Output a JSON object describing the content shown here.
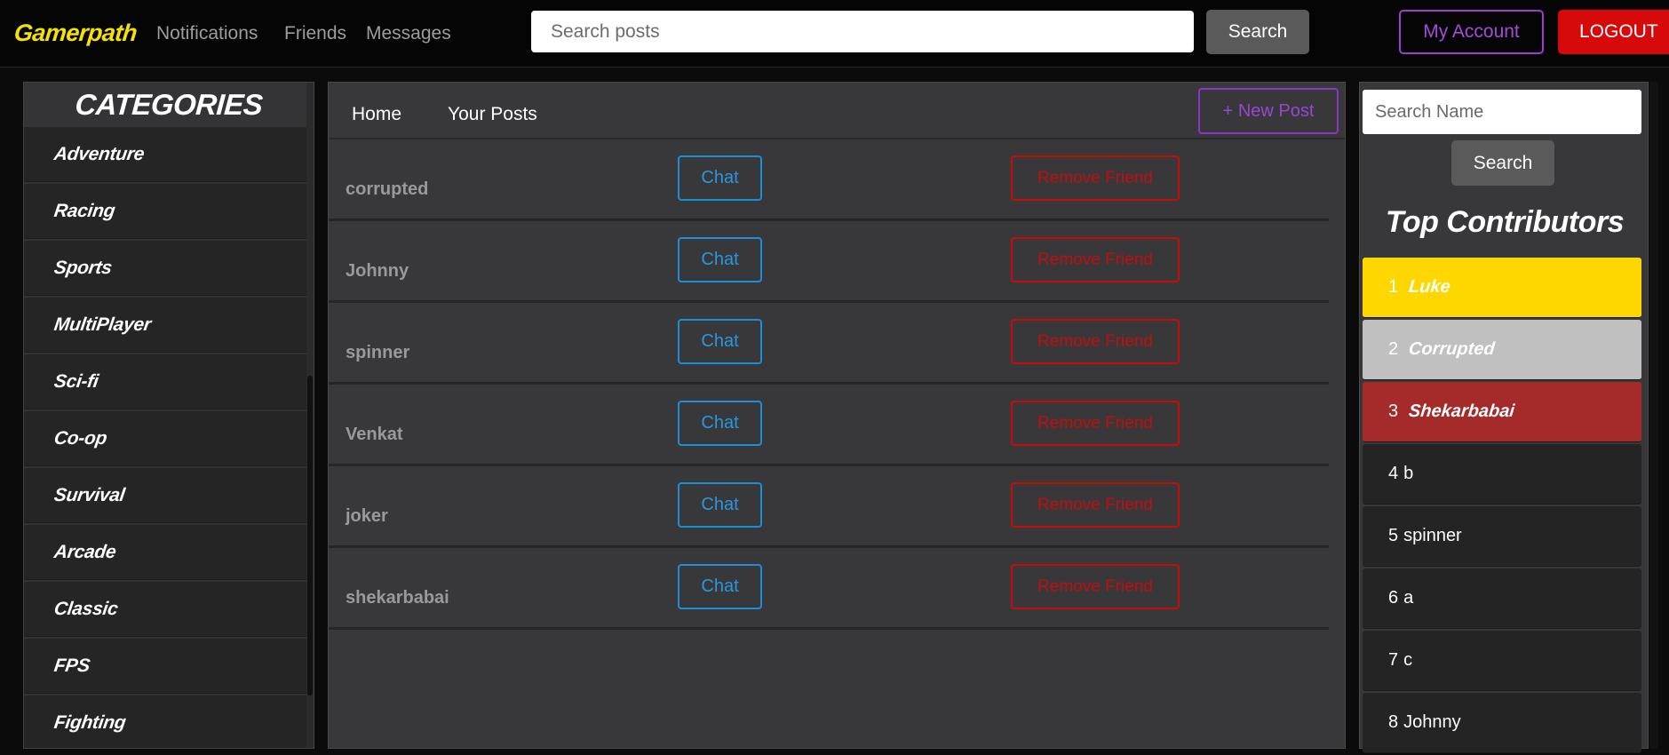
{
  "navbar": {
    "brand": "Gamerpath",
    "links": [
      "Notifications",
      "Friends",
      "Messages"
    ],
    "search_placeholder": "Search posts",
    "search_button": "Search",
    "account_button": "My Account",
    "logout_button": "LOGOUT"
  },
  "categories": {
    "title": "CATEGORIES",
    "items": [
      "Adventure",
      "Racing",
      "Sports",
      "MultiPlayer",
      "Sci-fi",
      "Co-op",
      "Survival",
      "Arcade",
      "Classic",
      "FPS",
      "Fighting"
    ]
  },
  "main": {
    "tabs": [
      "Home",
      "Your Posts"
    ],
    "new_post_button": "+ New Post",
    "chat_label": "Chat",
    "remove_label": "Remove Friend",
    "friends": [
      "corrupted",
      "Johnny",
      "spinner",
      "Venkat",
      "joker",
      "shekarbabai"
    ]
  },
  "right": {
    "search_placeholder": "Search Name",
    "search_button": "Search",
    "title": "Top Contributors",
    "contributors": [
      {
        "rank": "1",
        "name": "Luke"
      },
      {
        "rank": "2",
        "name": "Corrupted"
      },
      {
        "rank": "3",
        "name": "Shekarbabai"
      },
      {
        "rank": "4",
        "name": "b"
      },
      {
        "rank": "5",
        "name": "spinner"
      },
      {
        "rank": "6",
        "name": "a"
      },
      {
        "rank": "7",
        "name": "c"
      },
      {
        "rank": "8",
        "name": "Johnny"
      }
    ]
  },
  "colors": {
    "brand": "#f6e200",
    "accent_purple": "#9b3fd0",
    "danger_red": "#d60a0a",
    "chat_blue": "#1d8fd6",
    "gold": "#ffd700",
    "silver": "#c0c0c0",
    "bronze": "#a52a2a"
  }
}
